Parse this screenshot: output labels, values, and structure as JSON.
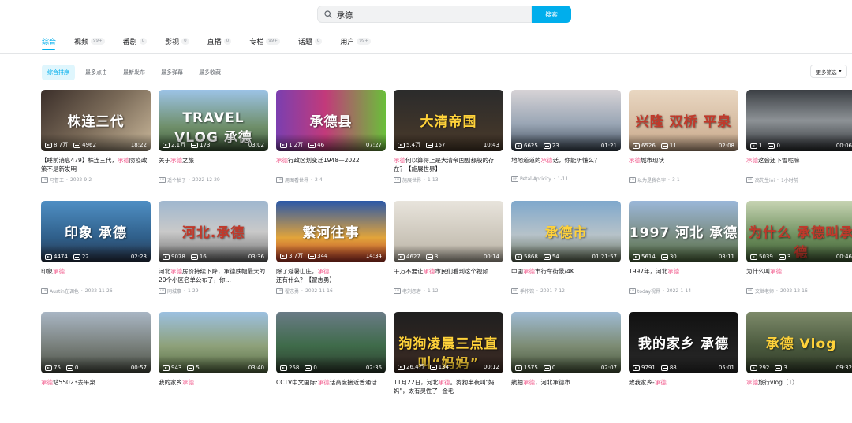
{
  "search": {
    "value": "承德",
    "button_label": "搜索"
  },
  "tabs": [
    {
      "label": "综合",
      "count": ""
    },
    {
      "label": "视频",
      "count": "99+"
    },
    {
      "label": "番剧",
      "count": "0"
    },
    {
      "label": "影视",
      "count": "0"
    },
    {
      "label": "直播",
      "count": "0"
    },
    {
      "label": "专栏",
      "count": "99+"
    },
    {
      "label": "话题",
      "count": "0"
    },
    {
      "label": "用户",
      "count": "99+"
    }
  ],
  "sort_options": [
    "综合排序",
    "最多点击",
    "最新发布",
    "最多弹幕",
    "最多收藏"
  ],
  "more_filter_label": "更多筛选",
  "videos": [
    {
      "title_pre": "【睡前消息479】株连三代，",
      "title_hl": "承德",
      "title_post": "防疫政策不是新发明",
      "up": "马督工",
      "date": "2022-9-2",
      "plays": "8.7万",
      "danmu": "4962",
      "duration": "18:22",
      "thumb_text": "株连三代",
      "bg": "linear-gradient(135deg,#3b2f2a,#7a6a58 50%,#c9b79a)",
      "text_color": "#ffffff"
    },
    {
      "title_pre": "关于",
      "title_hl": "承德",
      "title_post": "之旅",
      "up": "遥个柚子",
      "date": "2022-12-29",
      "plays": "2.1万",
      "danmu": "173",
      "duration": "03:02",
      "thumb_text": "TRAVEL VLOG 承德",
      "bg": "linear-gradient(180deg,#9cc3e6,#6f8f6a 60%,#3f5a3a)",
      "text_color": "#ffffff"
    },
    {
      "title_pre": "",
      "title_hl": "承德",
      "title_post": "行政区划变迁1948—2022",
      "up": "用图看世界",
      "date": "2-4",
      "plays": "1.2万",
      "danmu": "46",
      "duration": "07:27",
      "thumb_text": "承德县",
      "bg": "linear-gradient(90deg,#7b3fb0,#c23a7a 45%,#6abf3a)",
      "text_color": "#ffffff"
    },
    {
      "title_pre": "",
      "title_hl": "承德",
      "title_post": "何以算得上是大清帝国副都般的存在？【施展世界】",
      "up": "施展世界",
      "date": "1-13",
      "plays": "5.4万",
      "danmu": "157",
      "duration": "10:43",
      "thumb_text": "大清帝国",
      "bg": "linear-gradient(180deg,#2b2b2b,#4a3a2a)",
      "text_color": "#ffd23a"
    },
    {
      "title_pre": "地地道道的",
      "title_hl": "承德",
      "title_post": "话，你能听懂么？",
      "up": "Petal-Apricity",
      "date": "1-11",
      "plays": "6625",
      "danmu": "23",
      "duration": "01:21",
      "thumb_text": "",
      "bg": "linear-gradient(180deg,#d7d3d6,#9aa6b5 55%,#3e4a58)",
      "text_color": "#ffffff"
    },
    {
      "title_pre": "",
      "title_hl": "承德",
      "title_post": "城市现状",
      "up": "以为是我名字",
      "date": "3-1",
      "plays": "6526",
      "danmu": "11",
      "duration": "02:08",
      "thumb_text": "兴隆 双桥 平泉",
      "bg": "linear-gradient(180deg,#e9d7c2,#c8a88a)",
      "text_color": "#c0392b"
    },
    {
      "title_pre": "",
      "title_hl": "承德",
      "title_post": "这会还下雪呢嘛",
      "up": "高先生ioi",
      "date": "1小时前",
      "plays": "1",
      "danmu": "0",
      "duration": "00:06",
      "thumb_text": "",
      "bg": "linear-gradient(180deg,#3b3f44,#8d9296 50%,#2c2f33)",
      "text_color": "#ffffff"
    },
    {
      "title_pre": "印象",
      "title_hl": "承德",
      "title_post": "",
      "up": "Austin在调色",
      "date": "2022-11-26",
      "plays": "4474",
      "danmu": "22",
      "duration": "02:23",
      "thumb_text": "印象 承德",
      "bg": "linear-gradient(180deg,#4f8fc4,#2f5f8a 60%,#27344a)",
      "text_color": "#ffffff"
    },
    {
      "title_pre": "河北",
      "title_hl": "承德",
      "title_post": "房价持续下降，承德跌幅最大的20个小区名单公布了，你…",
      "up": "同城事",
      "date": "1-29",
      "plays": "9078",
      "danmu": "16",
      "duration": "03:36",
      "thumb_text": "河北.承德",
      "bg": "linear-gradient(180deg,#9fb7cf,#c9c9c9 50%,#6d6d6d)",
      "text_color": "#c0392b"
    },
    {
      "title_pre": "除了避暑山庄，",
      "title_hl": "承德",
      "title_post": "还有什么？【翟志勇】",
      "up": "翟志勇",
      "date": "2022-11-16",
      "plays": "3.7万",
      "danmu": "344",
      "duration": "14:34",
      "thumb_text": "繁河往事",
      "bg": "linear-gradient(180deg,#2a58a8,#e2a43a 60%,#b8362a)",
      "text_color": "#ffffff"
    },
    {
      "title_pre": "千万不要让",
      "title_hl": "承德",
      "title_post": "市民们看到这个视频",
      "up": "老刘忽者",
      "date": "1-12",
      "plays": "4627",
      "danmu": "3",
      "duration": "00:14",
      "thumb_text": "",
      "bg": "linear-gradient(180deg,#e8e4dc,#b9b2a4)",
      "text_color": "#222222"
    },
    {
      "title_pre": "中国",
      "title_hl": "承德",
      "title_post": "市行车街景/4K",
      "up": "手作馆",
      "date": "2021-7-12",
      "plays": "5868",
      "danmu": "54",
      "duration": "01:21:57",
      "thumb_text": "承德市",
      "bg": "linear-gradient(180deg,#7fa8cc,#b6c2c9 55%,#606b55)",
      "text_color": "#ffd23a"
    },
    {
      "title_pre": "1997年，河北",
      "title_hl": "承德",
      "title_post": "",
      "up": "today视界",
      "date": "2022-1-14",
      "plays": "5614",
      "danmu": "30",
      "duration": "03:11",
      "thumb_text": "1997 河北 承德",
      "bg": "linear-gradient(180deg,#9bb7d9,#7c8f86 55%,#4f6a3e)",
      "text_color": "#ffffff"
    },
    {
      "title_pre": "为什么叫",
      "title_hl": "承德",
      "title_post": "",
      "up": "文继老师",
      "date": "2022-12-16",
      "plays": "5039",
      "danmu": "3",
      "duration": "00:46",
      "thumb_text": "为什么 承德叫承德",
      "bg": "linear-gradient(180deg,#c7d4b3,#6a8c5a 60%,#3f5a35)",
      "text_color": "#c0392b"
    },
    {
      "title_pre": "",
      "title_hl": "承德",
      "title_post": "站55023去平泉",
      "up": "",
      "date": "",
      "plays": "75",
      "danmu": "0",
      "duration": "00:57",
      "thumb_text": "",
      "bg": "linear-gradient(180deg,#a9b6c4,#79807c 55%,#4a4f44)",
      "text_color": "#ffffff"
    },
    {
      "title_pre": "我的家乡",
      "title_hl": "承德",
      "title_post": "",
      "up": "",
      "date": "",
      "plays": "943",
      "danmu": "5",
      "duration": "03:40",
      "thumb_text": "",
      "bg": "linear-gradient(180deg,#9cc0e0,#8ea17a 55%,#566b43)",
      "text_color": "#ffffff"
    },
    {
      "title_pre": "CCTV中文国际:",
      "title_hl": "承德",
      "title_post": "话高度接近普通话",
      "up": "",
      "date": "",
      "plays": "258",
      "danmu": "0",
      "duration": "02:36",
      "thumb_text": "",
      "bg": "linear-gradient(180deg,#6a7b86,#3f6b4a 55%,#2c3a2c)",
      "text_color": "#ffffff"
    },
    {
      "title_pre": "11月22日，河北",
      "title_hl": "承德",
      "title_post": "。狗狗半夜叫\"妈妈\"，太有灵性了! 金毛",
      "up": "",
      "date": "",
      "plays": "26.4万",
      "danmu": "134",
      "duration": "00:12",
      "thumb_text": "狗狗凌晨三点直叫“妈妈”",
      "bg": "linear-gradient(180deg,#1f1f1f,#3d2b24)",
      "text_color": "#ffd23a"
    },
    {
      "title_pre": "航拍",
      "title_hl": "承德",
      "title_post": "，河北承德市",
      "up": "",
      "date": "",
      "plays": "1575",
      "danmu": "0",
      "duration": "02:07",
      "thumb_text": "",
      "bg": "linear-gradient(180deg,#9fbbd4,#7d8c74 55%,#46553a)",
      "text_color": "#ffffff"
    },
    {
      "title_pre": "致我家乡-",
      "title_hl": "承德",
      "title_post": "",
      "up": "",
      "date": "",
      "plays": "9791",
      "danmu": "88",
      "duration": "05:01",
      "thumb_text": "我的家乡 承德",
      "bg": "linear-gradient(180deg,#111111,#2a2a2a)",
      "text_color": "#ffffff"
    },
    {
      "title_pre": "",
      "title_hl": "承德",
      "title_post": "旅行vlog（1）",
      "up": "",
      "date": "",
      "plays": "292",
      "danmu": "3",
      "duration": "09:32",
      "thumb_text": "承德 Vlog",
      "bg": "linear-gradient(180deg,#7d8a6a,#4b5a3e 55%,#2f3a28)",
      "text_color": "#ffd23a"
    }
  ],
  "colors": {
    "accent": "#00aeec",
    "highlight": "#f25d8e",
    "muted": "#9499a0"
  }
}
